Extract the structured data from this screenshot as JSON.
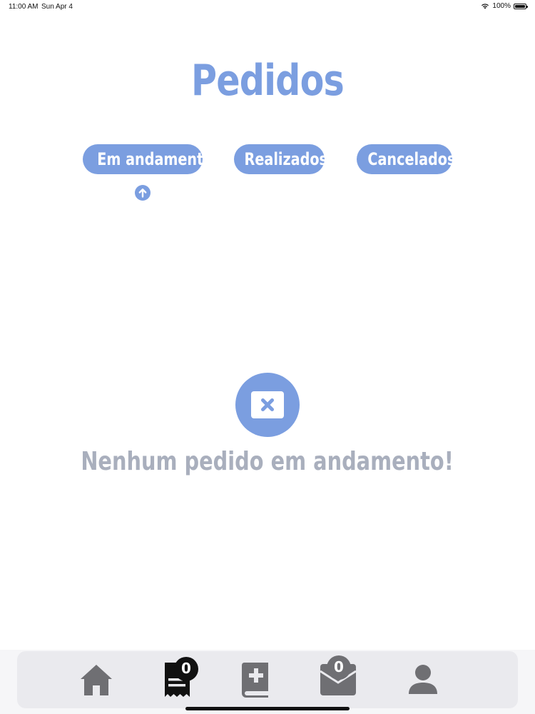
{
  "status_bar": {
    "time": "11:00 AM",
    "date": "Sun Apr 4",
    "battery": "100%"
  },
  "page": {
    "title": "Pedidos"
  },
  "tabs": [
    {
      "label": "Em andamento",
      "active": true
    },
    {
      "label": "Realizados",
      "active": false
    },
    {
      "label": "Cancelados",
      "active": false
    }
  ],
  "empty_state": {
    "icon": "x-box-icon",
    "message": "Nenhum pedido em andamento!"
  },
  "bottom_nav": {
    "items": [
      {
        "name": "home",
        "icon": "home-icon"
      },
      {
        "name": "orders",
        "icon": "receipt-icon",
        "badge": "0",
        "active": true
      },
      {
        "name": "catalog",
        "icon": "medical-book-icon"
      },
      {
        "name": "packages",
        "icon": "box-icon",
        "badge": "0"
      },
      {
        "name": "profile",
        "icon": "user-icon"
      }
    ]
  },
  "colors": {
    "accent": "#7b9ee0",
    "muted_text": "#a9afbd",
    "icon_gray": "#6f6f73",
    "active_icon": "#111111"
  }
}
